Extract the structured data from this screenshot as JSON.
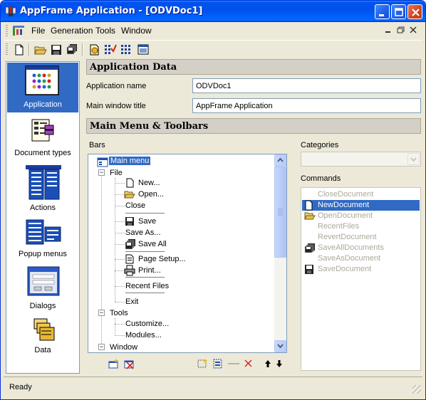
{
  "window": {
    "title": "AppFrame Application - [ODVDoc1]",
    "icon": "appframe-logo-icon"
  },
  "menubar": {
    "items": [
      "File",
      "Generation",
      "Tools",
      "Window"
    ]
  },
  "nav": {
    "items": [
      {
        "label": "Application",
        "icon": "application-grid-icon",
        "selected": true
      },
      {
        "label": "Document types",
        "icon": "document-types-icon",
        "selected": false
      },
      {
        "label": "Actions",
        "icon": "actions-icon",
        "selected": false
      },
      {
        "label": "Popup menus",
        "icon": "popup-menus-icon",
        "selected": false
      },
      {
        "label": "Dialogs",
        "icon": "dialogs-icon",
        "selected": false
      },
      {
        "label": "Data",
        "icon": "data-icon",
        "selected": false
      }
    ]
  },
  "app_data": {
    "heading": "Application Data",
    "name_label": "Application name",
    "name_value": "ODVDoc1",
    "title_label": "Main window title",
    "title_value": "AppFrame Application"
  },
  "menus": {
    "heading": "Main Menu & Toolbars",
    "bars_label": "Bars",
    "categories_label": "Categories",
    "commands_label": "Commands",
    "tree": {
      "root": "Main menu",
      "file": "File",
      "file_items": [
        "New...",
        "Open...",
        "Close",
        "Save",
        "Save As...",
        "Save All",
        "Page Setup...",
        "Print...",
        "Recent Files",
        "Exit"
      ],
      "tools": "Tools",
      "tools_items": [
        "Customize...",
        "Modules..."
      ],
      "window": "Window"
    },
    "commands": [
      "CloseDocument",
      "NewDocument",
      "OpenDocument",
      "RecentFiles",
      "RevertDocument",
      "SaveAllDocuments",
      "SaveAsDocument",
      "SaveDocument"
    ],
    "selected_command": "NewDocument"
  },
  "status": {
    "text": "Ready"
  },
  "colors": {
    "selection": "#316AC5",
    "titlebar": "#0054E3",
    "face": "#ECE9D8"
  }
}
